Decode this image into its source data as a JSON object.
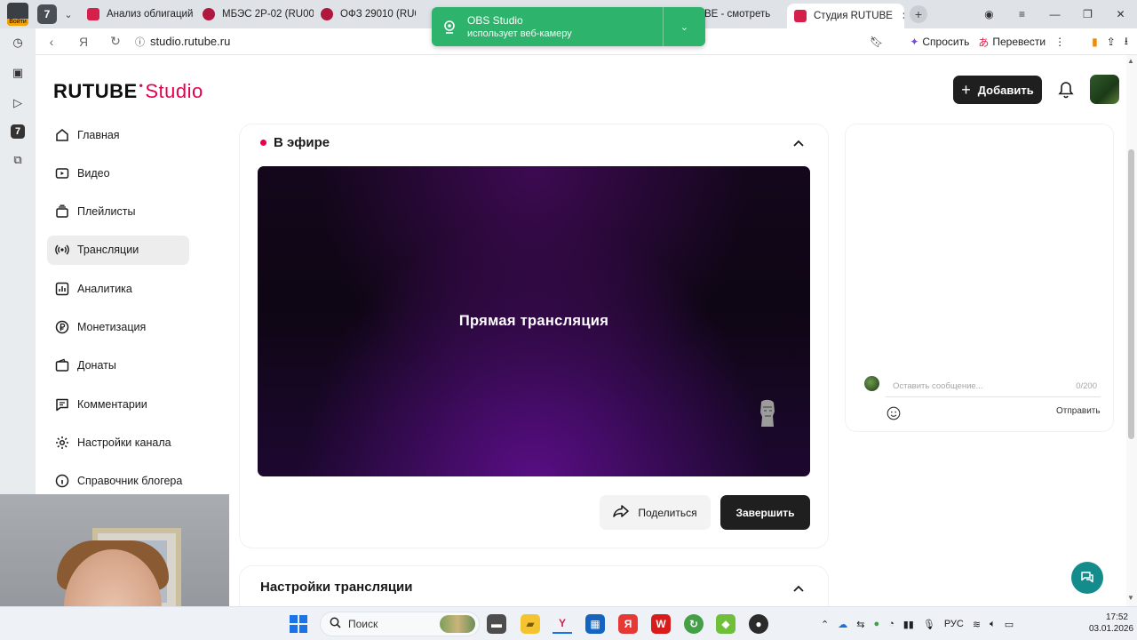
{
  "browser": {
    "window_avatar_label": "Войти",
    "tab_count_badge": "7",
    "tabs": [
      {
        "title": "Анализ облигаций",
        "favicon_color": "#d6204c"
      },
      {
        "title": "МБЭС 2Р-02 (RU00",
        "favicon_color": "#b0173f"
      },
      {
        "title": "ОФЗ 29010 (RU00",
        "favicon_color": "#b0173f"
      },
      {
        "title": "RUTUBE - смотреть",
        "favicon_color": "#d6204c"
      },
      {
        "title": "Студия RUTUBE",
        "favicon_color": "#d6204c",
        "active": true
      }
    ],
    "url": "studio.rutube.ru",
    "ask_label": "Спросить",
    "translate_label": "Перевести",
    "sidepanel_badge": "7"
  },
  "notification": {
    "app": "OBS Studio",
    "message": "использует веб-камеру",
    "hidden_text": "Студия RUTUBE"
  },
  "header": {
    "logo_main": "RUTUBE",
    "logo_studio": "Studio",
    "add_label": "Добавить"
  },
  "nav": {
    "items": [
      {
        "label": "Главная",
        "icon": "home-icon"
      },
      {
        "label": "Видео",
        "icon": "video-icon"
      },
      {
        "label": "Плейлисты",
        "icon": "playlist-icon"
      },
      {
        "label": "Трансляции",
        "icon": "broadcast-icon",
        "active": true
      },
      {
        "label": "Аналитика",
        "icon": "analytics-icon"
      },
      {
        "label": "Монетизация",
        "icon": "ruble-icon"
      },
      {
        "label": "Донаты",
        "icon": "wallet-icon"
      },
      {
        "label": "Комментарии",
        "icon": "comment-icon"
      },
      {
        "label": "Настройки канала",
        "icon": "gear-icon"
      },
      {
        "label": "Справочник блогера",
        "icon": "info-icon"
      }
    ]
  },
  "live": {
    "heading": "В эфире",
    "player_title": "Прямая трансляция",
    "share_label": "Поделиться",
    "end_label": "Завершить"
  },
  "settings": {
    "heading": "Настройки трансляции"
  },
  "chat": {
    "placeholder": "Оставить сообщение...",
    "counter": "0/200",
    "send_label": "Отправить"
  },
  "taskbar": {
    "search_label": "Поиск",
    "language": "РУС",
    "time": "17:52",
    "date": "03.01.2026"
  },
  "colors": {
    "brand": "#e6004c",
    "dark_button": "#1f1f1f",
    "notification": "#2db36b",
    "support": "#148c8c"
  }
}
